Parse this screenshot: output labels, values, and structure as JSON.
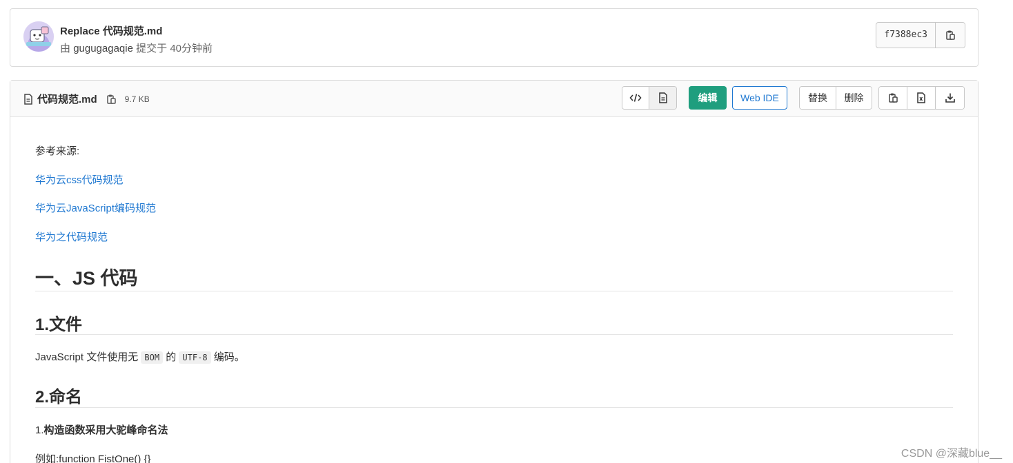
{
  "commit": {
    "title": "Replace 代码规范.md",
    "by": "由",
    "author": "gugugagaqie",
    "action": "提交于",
    "time": "40分钟前",
    "sha": "f7388ec3"
  },
  "file": {
    "name": "代码规范.md",
    "size": "9.7 KB",
    "edit_label": "编辑",
    "webide_label": "Web IDE",
    "replace_label": "替换",
    "delete_label": "删除"
  },
  "content": {
    "source_label": "参考来源:",
    "links": [
      "华为云css代码规范",
      "华为云JavaScript编码规范",
      "华为之代码规范"
    ],
    "h1": "一、JS 代码",
    "section1": "1.文件",
    "p1_pre": "JavaScript 文件使用无",
    "p1_code1": "BOM",
    "p1_mid": "的",
    "p1_code2": "UTF-8",
    "p1_post": "编码。",
    "section2": "2.命名",
    "rule1_num": "1.",
    "rule1_text": "构造函数采用大驼峰命名法",
    "example_label": "例如:",
    "example_code": "function FistOne() {}"
  },
  "watermark": "CSDN @深藏blue__",
  "colors": {
    "primary": "#1f9e7e",
    "link": "#1f78d1"
  }
}
